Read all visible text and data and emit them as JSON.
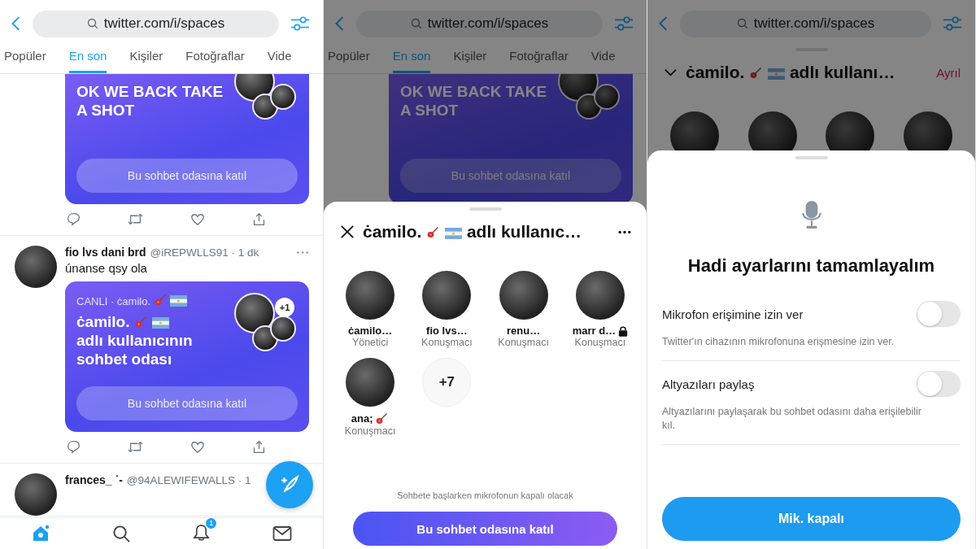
{
  "panels": [
    {
      "kind": "feed",
      "dimmed": false,
      "url": "twitter.com/i/spaces",
      "tabs": [
        {
          "label": "Popüler",
          "selected": false
        },
        {
          "label": "En son",
          "selected": true
        },
        {
          "label": "Kişiler",
          "selected": false
        },
        {
          "label": "Fotoğraflar",
          "selected": false
        },
        {
          "label": "Vide",
          "selected": false
        }
      ],
      "tweets": [
        {
          "kind": "space_only",
          "space": {
            "title": "OK WE BACK TAKE A SHOT",
            "join": "Bu sohbet odasına katıl"
          }
        },
        {
          "kind": "tweet",
          "name": "fio lvs dani brd",
          "handle": "@iREPWLLS91 · 1 dk",
          "text": "únanse qsy ola",
          "space": {
            "live": "CANLI · ċamilo.",
            "title_start": "ċamilo.",
            "title_end": "adlı kullanıcının sohbet odası",
            "extra": "+1",
            "join": "Bu sohbet odasına katıl"
          }
        },
        {
          "kind": "tweet",
          "name": "frances_ ˙-",
          "handle": "@94ALEWIFEWALLS · 1"
        }
      ],
      "nav_badge": "1"
    },
    {
      "kind": "space_preview",
      "dimmed": true,
      "url": "twitter.com/i/spaces",
      "tabs": [
        {
          "label": "Popüler",
          "selected": false
        },
        {
          "label": "En son",
          "selected": true
        },
        {
          "label": "Kişiler",
          "selected": false
        },
        {
          "label": "Fotoğraflar",
          "selected": false
        },
        {
          "label": "Vide",
          "selected": false
        }
      ],
      "tweets": [
        {
          "kind": "space_only",
          "space": {
            "title": "OK WE BACK TAKE A SHOT",
            "join": "Bu sohbet odasına katıl"
          }
        }
      ],
      "sheet": {
        "title_start": "ċamilo.",
        "title_end": "adlı kullanıc…",
        "participants": [
          {
            "kind": "plain",
            "name": "ċamilo…",
            "role": "Yönetici",
            "locked": false
          },
          {
            "kind": "plain",
            "name": "fio lvs…",
            "role": "Konuşmacı",
            "locked": false
          },
          {
            "kind": "plain",
            "name": "renu…",
            "role": "Konuşmacı",
            "locked": false
          },
          {
            "kind": "plain",
            "name": "marr d…",
            "role": "Konuşmacı",
            "locked": true
          },
          {
            "kind": "guitar",
            "name": "ana;",
            "role": "Konuşmacı",
            "locked": false
          }
        ],
        "more_count": "+7",
        "note": "Sohbete başlarken mikrofonun kapalı olacak",
        "join": "Bu sohbet odasına katıl"
      }
    },
    {
      "kind": "settings",
      "dimmed": true,
      "url": "twitter.com/i/spaces",
      "sheet": {
        "title_start": "ċamilo.",
        "title_end": "adlı kullanı…",
        "leave": "Ayrıl"
      },
      "dialog": {
        "heading": "Hadi ayarlarını tamamlayalım",
        "settings": [
          {
            "label": "Mikrofon erişimine izin ver",
            "description": "Twitter'ın cihazının mikrofonuna erişmesine izin ver.",
            "on": false
          },
          {
            "label": "Altyazıları paylaş",
            "description": "Altyazılarını paylaşarak bu sohbet odasını daha erişilebilir kıl.",
            "on": false
          }
        ],
        "button": "Mik. kapalı"
      }
    }
  ]
}
